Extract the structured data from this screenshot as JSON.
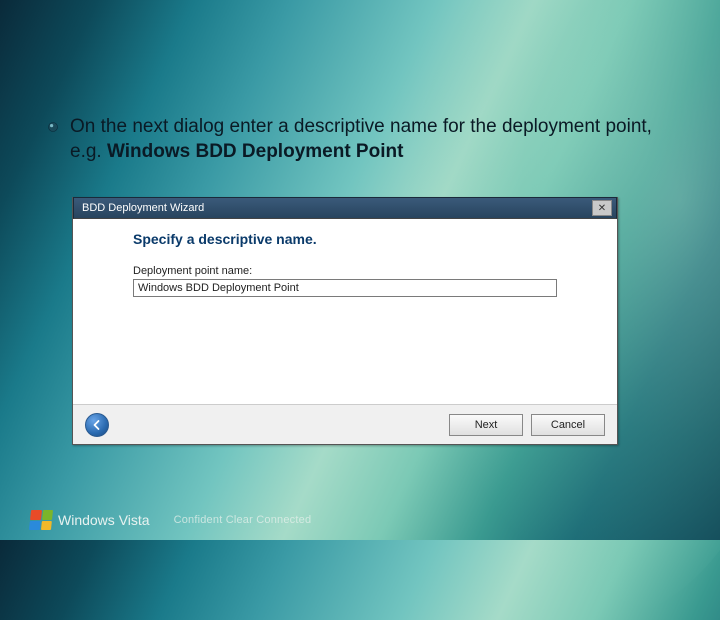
{
  "bullet": {
    "text_pre": "On the next dialog enter a descriptive name for the deployment point, e.g. ",
    "bold": "Windows BDD Deployment Point"
  },
  "wizard": {
    "title": "BDD Deployment Wizard",
    "heading": "Specify a descriptive name.",
    "field_label": "Deployment point name:",
    "field_value": "Windows BDD Deployment Point",
    "buttons": {
      "next": "Next",
      "cancel": "Cancel"
    }
  },
  "brand": {
    "windows": "Windows",
    "vista": "Vista",
    "slogan": "Confident   Clear   Connected"
  }
}
